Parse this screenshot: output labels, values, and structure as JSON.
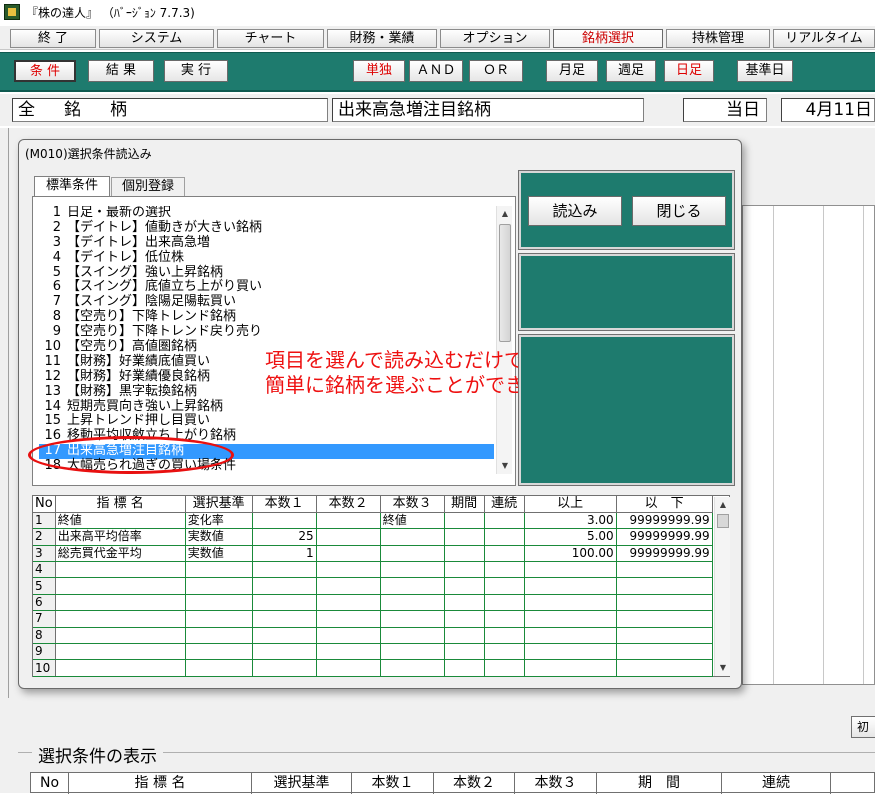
{
  "window": {
    "title": "『株の達人』 （ﾊﾞｰｼﾞｮﾝ 7.7.3)"
  },
  "main_menu": {
    "items": [
      "終 了",
      "システム",
      "チャート",
      "財務・業績",
      "オプション",
      "銘柄選択",
      "持株管理",
      "リアルタイム"
    ],
    "active": "銘柄選択"
  },
  "toolbar": {
    "condition": "条 件",
    "result": "結 果",
    "execute": "実 行",
    "single": "単独",
    "and": "ＡＮＤ",
    "or": "ＯＲ",
    "monthly": "月足",
    "weekly": "週足",
    "daily": "日足",
    "base_date": "基準日"
  },
  "infobar": {
    "scope": "全　銘　柄",
    "condition_name": "出来高急増注目銘柄",
    "day_label": "当日",
    "date": "4月11日"
  },
  "dialog": {
    "title": "(M010)選択条件読込み",
    "tab_standard": "標準条件",
    "tab_individual": "個別登録",
    "load_button": "読込み",
    "close_button": "閉じる",
    "list": [
      {
        "no": "1",
        "label": "日足・最新の選択"
      },
      {
        "no": "2",
        "label": "【デイトレ】値動きが大きい銘柄"
      },
      {
        "no": "3",
        "label": "【デイトレ】出来高急増"
      },
      {
        "no": "4",
        "label": "【デイトレ】低位株"
      },
      {
        "no": "5",
        "label": "【スイング】強い上昇銘柄"
      },
      {
        "no": "6",
        "label": "【スイング】底値立ち上がり買い"
      },
      {
        "no": "7",
        "label": "【スイング】陰陽足陽転買い"
      },
      {
        "no": "8",
        "label": "【空売り】下降トレンド銘柄"
      },
      {
        "no": "9",
        "label": "【空売り】下降トレンド戻り売り"
      },
      {
        "no": "10",
        "label": "【空売り】高値圏銘柄"
      },
      {
        "no": "11",
        "label": "【財務】好業績底値買い"
      },
      {
        "no": "12",
        "label": "【財務】好業績優良銘柄"
      },
      {
        "no": "13",
        "label": "【財務】黒字転換銘柄"
      },
      {
        "no": "14",
        "label": "短期売買向き強い上昇銘柄"
      },
      {
        "no": "15",
        "label": "上昇トレンド押し目買い"
      },
      {
        "no": "16",
        "label": "移動平均収斂立ち上がり銘柄"
      },
      {
        "no": "17",
        "label": "出来高急増注目銘柄"
      },
      {
        "no": "18",
        "label": "大幅売られ過ぎの買い場条件"
      }
    ],
    "selected_no": "17",
    "annotation_line1": "項目を選んで読み込むだけで",
    "annotation_line2": "簡単に銘柄を選ぶことができます。",
    "grid": {
      "headers": [
        "No",
        "指 標 名",
        "選択基準",
        "本数１",
        "本数２",
        "本数３",
        "期間",
        "連続",
        "以上",
        "以　下"
      ],
      "rows": [
        {
          "no": "1",
          "name": "終値",
          "basis": "変化率",
          "n1": "",
          "n2": "",
          "n3": "終値",
          "period": "",
          "cont": "",
          "min": "3.00",
          "max": "99999999.99"
        },
        {
          "no": "2",
          "name": "出来高平均倍率",
          "basis": "実数値",
          "n1": "25",
          "n2": "",
          "n3": "",
          "period": "",
          "cont": "",
          "min": "5.00",
          "max": "99999999.99"
        },
        {
          "no": "3",
          "name": "総売買代金平均",
          "basis": "実数値",
          "n1": "1",
          "n2": "",
          "n3": "",
          "period": "",
          "cont": "",
          "min": "100.00",
          "max": "99999999.99"
        },
        {
          "no": "4",
          "name": "",
          "basis": "",
          "n1": "",
          "n2": "",
          "n3": "",
          "period": "",
          "cont": "",
          "min": "",
          "max": ""
        },
        {
          "no": "5",
          "name": "",
          "basis": "",
          "n1": "",
          "n2": "",
          "n3": "",
          "period": "",
          "cont": "",
          "min": "",
          "max": ""
        },
        {
          "no": "6",
          "name": "",
          "basis": "",
          "n1": "",
          "n2": "",
          "n3": "",
          "period": "",
          "cont": "",
          "min": "",
          "max": ""
        },
        {
          "no": "7",
          "name": "",
          "basis": "",
          "n1": "",
          "n2": "",
          "n3": "",
          "period": "",
          "cont": "",
          "min": "",
          "max": ""
        },
        {
          "no": "8",
          "name": "",
          "basis": "",
          "n1": "",
          "n2": "",
          "n3": "",
          "period": "",
          "cont": "",
          "min": "",
          "max": ""
        },
        {
          "no": "9",
          "name": "",
          "basis": "",
          "n1": "",
          "n2": "",
          "n3": "",
          "period": "",
          "cont": "",
          "min": "",
          "max": ""
        },
        {
          "no": "10",
          "name": "",
          "basis": "",
          "n1": "",
          "n2": "",
          "n3": "",
          "period": "",
          "cont": "",
          "min": "",
          "max": ""
        }
      ]
    }
  },
  "background": {
    "init_button": "初",
    "display_section_label": "選択条件の表示",
    "display_headers": [
      "No",
      "指 標 名",
      "選択基準",
      "本数１",
      "本数２",
      "本数３",
      "期　間",
      "連続"
    ]
  },
  "colors": {
    "teal": "#1e7b6e",
    "accent_red": "#dd0000",
    "selection_blue": "#3399ff",
    "grid_green": "#1a8a3a"
  },
  "icons": {
    "app": "app-logo-icon",
    "scroll_up": "scroll-up-arrow-icon",
    "scroll_down": "scroll-down-arrow-icon"
  }
}
